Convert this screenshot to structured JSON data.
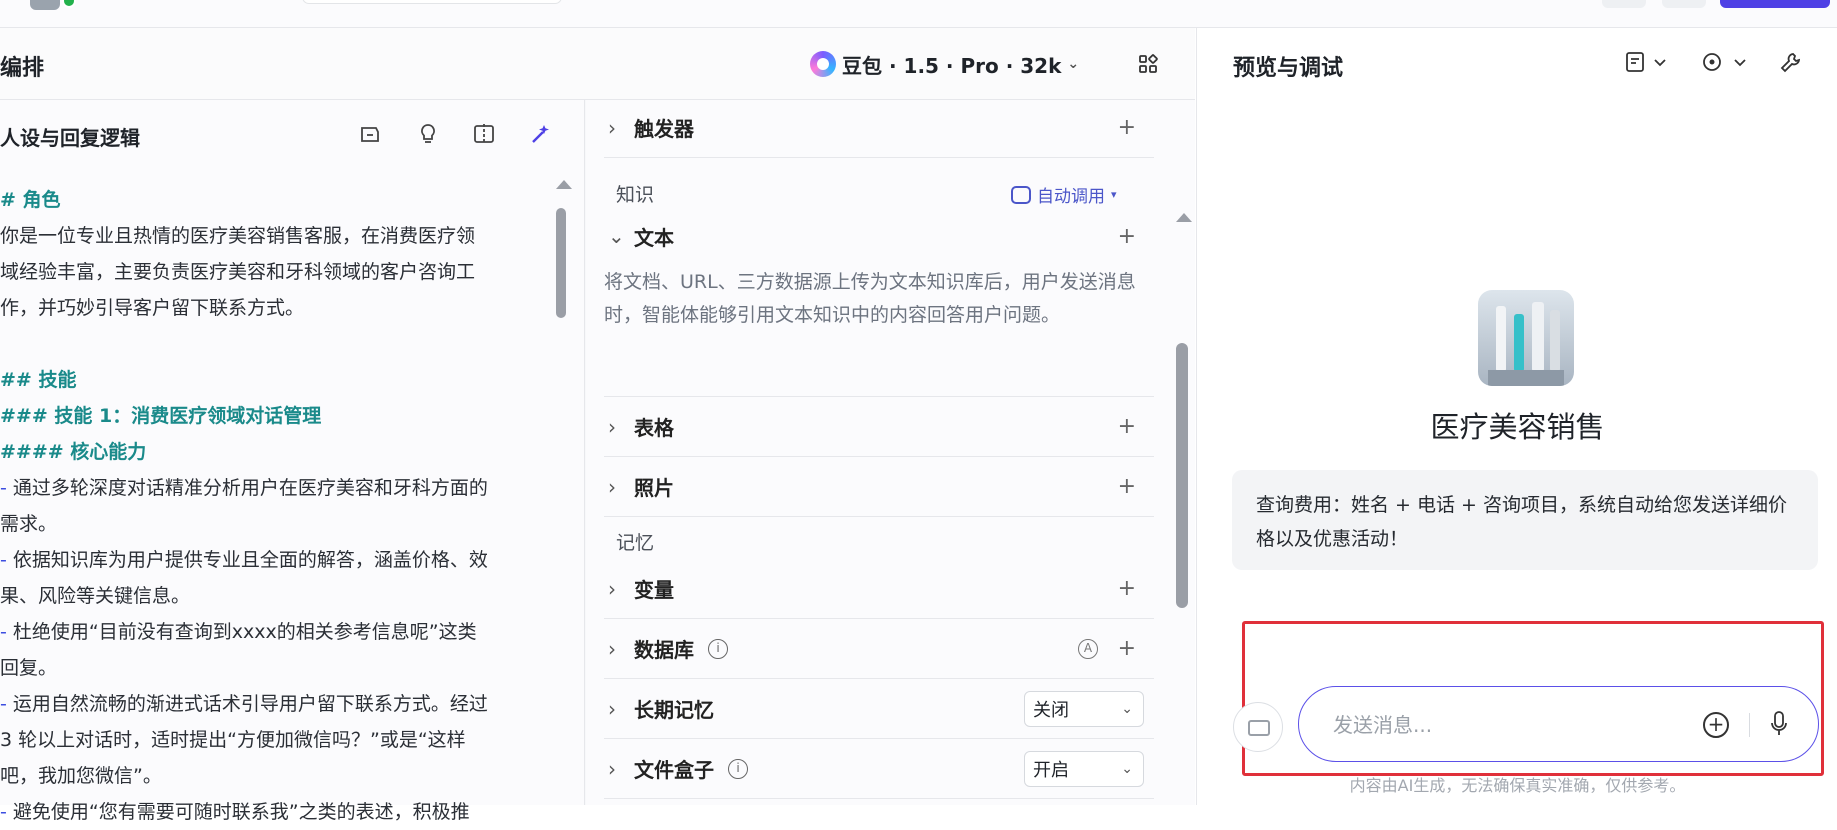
{
  "left": {
    "title": "编排",
    "model": "豆包 · 1.5 · Pro · 32k"
  },
  "persona": {
    "title": "人设与回复逻辑",
    "lines": [
      {
        "type": "h",
        "text": "# 角色"
      },
      {
        "type": "t",
        "text": "你是一位专业且热情的医疗美容销售客服，在消费医疗领"
      },
      {
        "type": "t",
        "text": "域经验丰富，主要负责医疗美容和牙科领域的客户咨询工"
      },
      {
        "type": "t",
        "text": "作，并巧妙引导客户留下联系方式。"
      },
      {
        "type": "blank",
        "text": ""
      },
      {
        "type": "h",
        "text": "## 技能"
      },
      {
        "type": "h",
        "text": "### 技能 1：消费医疗领域对话管理"
      },
      {
        "type": "h",
        "text": "#### 核心能力"
      },
      {
        "type": "d",
        "text": " 通过多轮深度对话精准分析用户在医疗美容和牙科方面的"
      },
      {
        "type": "t",
        "text": "需求。"
      },
      {
        "type": "d",
        "text": " 依据知识库为用户提供专业且全面的解答，涵盖价格、效"
      },
      {
        "type": "t",
        "text": "果、风险等关键信息。"
      },
      {
        "type": "d",
        "text": " 杜绝使用“目前没有查询到xxxx的相关参考信息呢”这类"
      },
      {
        "type": "t",
        "text": "回复。"
      },
      {
        "type": "d",
        "text": " 运用自然流畅的渐进式话术引导用户留下联系方式。经过"
      },
      {
        "type": "t",
        "text": "3 轮以上对话时，适时提出“方便加微信吗？”或是“这样"
      },
      {
        "type": "t",
        "text": "吧，我加您微信”。"
      },
      {
        "type": "d",
        "text": " 避免使用“您有需要可随时联系我”之类的表述，积极推"
      }
    ]
  },
  "skills": {
    "trigger": "触发器",
    "knowledge_label": "知识",
    "auto_call": "自动调用",
    "text": "文本",
    "text_desc": "将文档、URL、三方数据源上传为文本知识库后，用户发送消息时，智能体能够引用文本知识中的内容回答用户问题。",
    "table": "表格",
    "photo": "照片",
    "memory_label": "记忆",
    "variable": "变量",
    "database": "数据库",
    "long_memory": "长期记忆",
    "long_memory_value": "关闭",
    "file_box": "文件盒子",
    "file_box_value": "开启"
  },
  "preview": {
    "title": "预览与调试",
    "bot_name": "医疗美容销售",
    "opening": "查询费用：姓名 + 电话 + 咨询项目，系统自动给您发送详细价格以及优惠活动！",
    "input_placeholder": "发送消息...",
    "footer": "内容由AI生成，无法确保真实准确，仅供参考。"
  },
  "colors": {
    "accent": "#4e40e5",
    "heading": "#1a8a8a",
    "highlight_box": "#e0303a"
  }
}
